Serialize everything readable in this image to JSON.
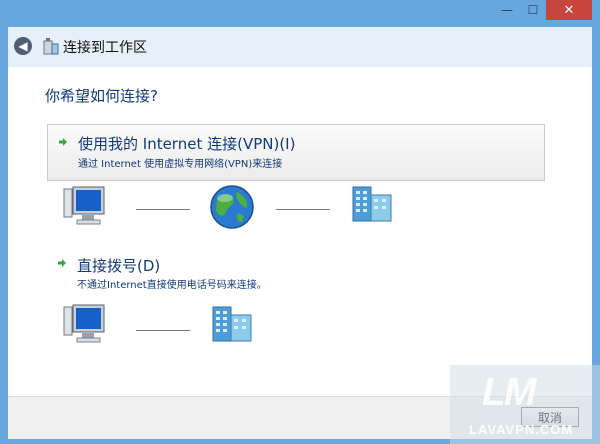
{
  "window": {
    "title": "连接到工作区",
    "controls": {
      "minimize": "—",
      "maximize": "☐",
      "close": "✕"
    }
  },
  "content": {
    "question": "你希望如何连接?",
    "options": [
      {
        "title": "使用我的 Internet 连接(VPN)(I)",
        "description": "通过 Internet 使用虚拟专用网络(VPN)来连接",
        "icon": "green-arrow-icon"
      },
      {
        "title": "直接拨号(D)",
        "description": "不通过Internet直接使用电话号码来连接。",
        "icon": "green-arrow-icon"
      }
    ]
  },
  "footer": {
    "cancel_label": "取消"
  },
  "watermark": {
    "logo": "LM",
    "url": "LAVAVPN.COM"
  },
  "colors": {
    "frame": "#68a7dd",
    "close_button": "#c7453c",
    "accent_text": "#123b7a"
  }
}
